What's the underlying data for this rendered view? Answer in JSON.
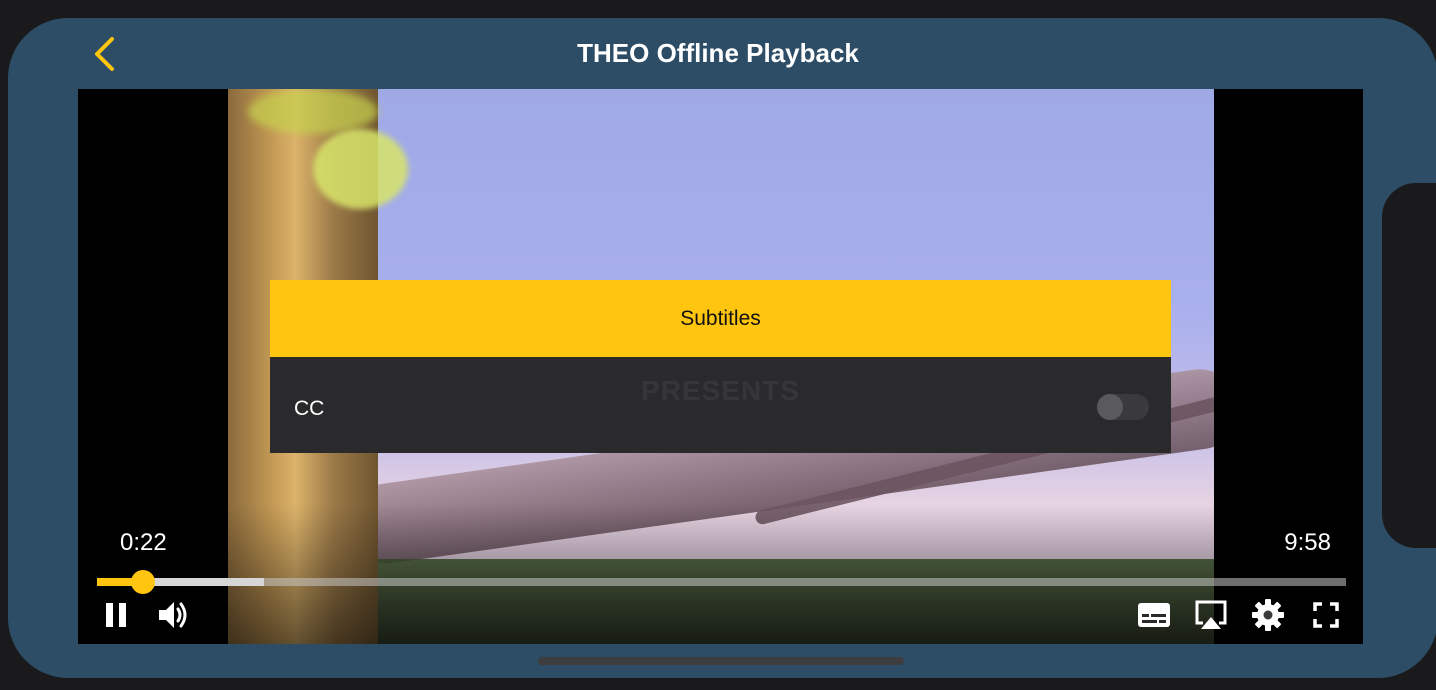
{
  "nav": {
    "title": "THEO Offline Playback",
    "back_icon": "chevron-left-icon"
  },
  "colors": {
    "accent": "#ffc50f",
    "chrome": "#2d4d66",
    "panel": "#2a2a2c"
  },
  "subtitles_menu": {
    "header": "Subtitles",
    "watermark": "PRESENTS",
    "items": [
      {
        "label": "CC",
        "enabled": false
      }
    ]
  },
  "playback": {
    "current_time": "0:22",
    "duration": "9:58",
    "progress_fraction": 0.037,
    "buffered_fraction": 0.134
  },
  "controls": {
    "left": [
      "pause-icon",
      "volume-icon"
    ],
    "right": [
      "subtitles-icon",
      "airplay-icon",
      "settings-gear-icon",
      "fullscreen-icon"
    ]
  }
}
